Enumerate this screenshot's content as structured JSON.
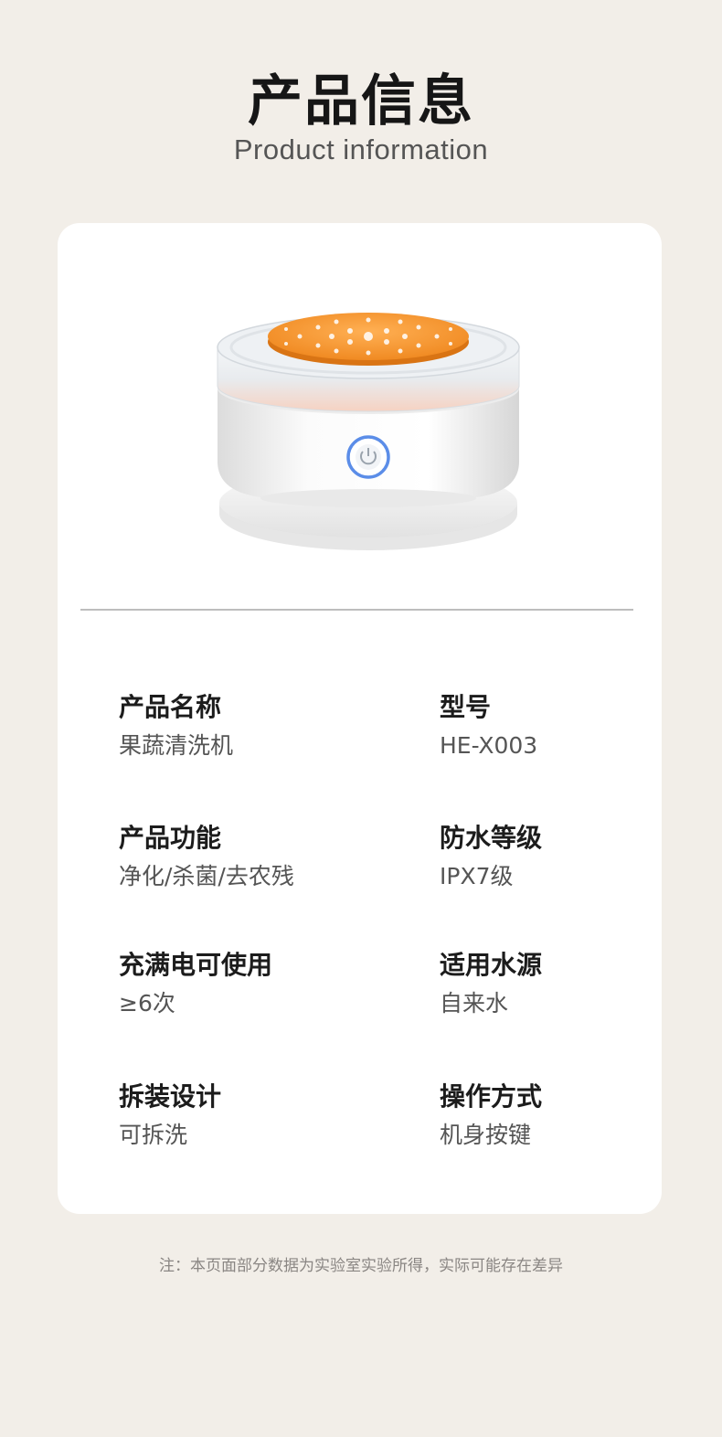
{
  "header": {
    "title_zh": "产品信息",
    "title_en": "Product information"
  },
  "product": {
    "image_name": "fruit-vegetable-washer-photo",
    "accent_color": "#f2912d",
    "button_ring_color": "#5b8de8"
  },
  "specs": [
    {
      "label": "产品名称",
      "value": "果蔬清洗机"
    },
    {
      "label": "型号",
      "value": "HE-X003"
    },
    {
      "label": "产品功能",
      "value": "净化/杀菌/去农残"
    },
    {
      "label": "防水等级",
      "value": "IPX7级"
    },
    {
      "label": "充满电可使用",
      "value": "≥6次"
    },
    {
      "label": "适用水源",
      "value": "自来水"
    },
    {
      "label": "拆装设计",
      "value": "可拆洗"
    },
    {
      "label": "操作方式",
      "value": "机身按键"
    }
  ],
  "footer": {
    "note": "注：本页面部分数据为实验室实验所得，实际可能存在差异"
  },
  "colors": {
    "page_background": "#f2eee8",
    "card_background": "#ffffff"
  }
}
